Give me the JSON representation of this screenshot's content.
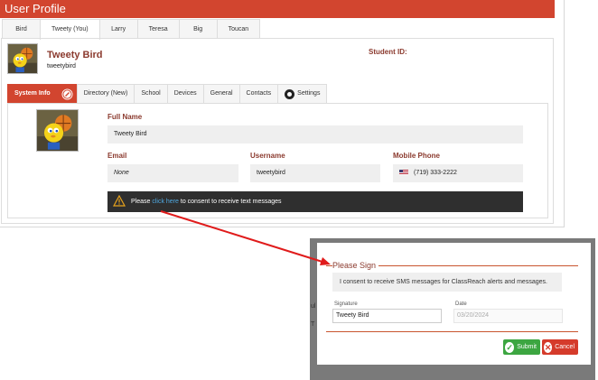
{
  "window": {
    "title": "User Profile"
  },
  "user_tabs": [
    "Bird",
    "Tweety (You)",
    "Larry",
    "Teresa",
    "Big",
    "Toucan"
  ],
  "profile": {
    "display_name": "Tweety Bird",
    "username_handle": "tweetybird",
    "student_id_label": "Student ID:"
  },
  "sub_tabs": {
    "system_info": "System Info",
    "directory": "Directory (New)",
    "school": "School",
    "devices": "Devices",
    "general": "General",
    "contacts": "Contacts",
    "settings": "Settings"
  },
  "fields": {
    "full_name_label": "Full Name",
    "full_name_value": "Tweety Bird",
    "email_label": "Email",
    "email_value": "None",
    "username_label": "Username",
    "username_value": "tweetybird",
    "mobile_label": "Mobile Phone",
    "mobile_value": "(719) 333-2222"
  },
  "notice": {
    "prefix": "Please ",
    "link": "click here",
    "suffix": " to consent to receive text messages"
  },
  "modal": {
    "title": "Please Sign",
    "consent_text": "I consent to receive SMS messages for ClassReach alerts and messages.",
    "signature_label": "Signature",
    "signature_value": "Tweety Bird",
    "date_label": "Date",
    "date_value": "03/20/2024",
    "submit_label": "Submit",
    "cancel_label": "Cancel"
  },
  "colors": {
    "brand": "#d2452f",
    "label": "#8b3a2e",
    "notice_bg": "#2f2f2f",
    "link": "#4fa8e0",
    "submit": "#3ca641",
    "cancel": "#d53b2b",
    "arrow": "#e01b1b"
  },
  "icons": {
    "edit": "edit-icon",
    "settings": "gear-icon",
    "warning": "warning-icon",
    "flag": "us-flag-icon",
    "submit": "check-icon",
    "cancel": "x-icon"
  }
}
